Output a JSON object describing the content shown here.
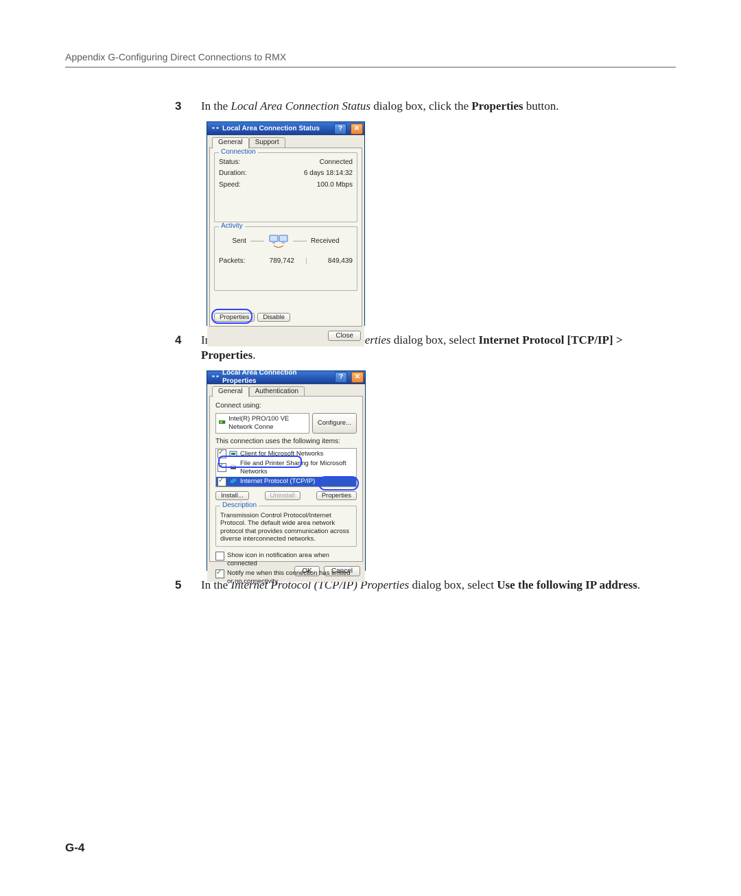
{
  "header": "Appendix G-Configuring Direct Connections to RMX",
  "page_number": "G-4",
  "steps": {
    "s3": {
      "num": "3",
      "t1": "In the ",
      "it1": "Local Area Connection Status",
      "t2": " dialog box, click the ",
      "bd1": "Properties",
      "t3": " button."
    },
    "s4": {
      "num": "4",
      "t1": "In the ",
      "it1": "Local Area Connection Properties",
      "t2": " dialog box, select ",
      "bd1": "Internet Protocol [TCP/IP] > Properties",
      "t3": "."
    },
    "s5": {
      "num": "5",
      "t1": "In the ",
      "it1": "Internet Protocol (TCP/IP) Properties",
      "t2": " dialog box, select ",
      "bd1": "Use the following IP address",
      "t3": "."
    }
  },
  "dlg1": {
    "title": "Local Area Connection Status",
    "tabs": {
      "general": "General",
      "support": "Support"
    },
    "conn_legend": "Connection",
    "status_l": "Status:",
    "status_v": "Connected",
    "duration_l": "Duration:",
    "duration_v": "6 days 18:14:32",
    "speed_l": "Speed:",
    "speed_v": "100.0 Mbps",
    "act_legend": "Activity",
    "sent": "Sent",
    "received": "Received",
    "packets_l": "Packets:",
    "packets_sent": "789,742",
    "packets_recv": "849,439",
    "btn_properties": "Properties",
    "btn_disable": "Disable",
    "btn_close": "Close",
    "help_icon": "help-icon",
    "close_icon": "close-icon"
  },
  "dlg2": {
    "title": "Local Area Connection Properties",
    "tabs": {
      "general": "General",
      "auth": "Authentication"
    },
    "connect_using": "Connect using:",
    "adapter": "Intel(R) PRO/100 VE Network Conne",
    "btn_configure": "Configure...",
    "uses_items": "This connection uses the following items:",
    "items": {
      "i0": "Client for Microsoft Networks",
      "i1": "File and Printer Sharing for Microsoft Networks",
      "i2": "Internet Protocol (TCP/IP)"
    },
    "btn_install": "Install...",
    "btn_uninstall": "Uninstall",
    "btn_properties": "Properties",
    "desc_legend": "Description",
    "desc_text": "Transmission Control Protocol/Internet Protocol. The default wide area network protocol that provides communication across diverse interconnected networks.",
    "chk_show": "Show icon in notification area when connected",
    "chk_notify": "Notify me when this connection has limited or no connectivity",
    "btn_ok": "OK",
    "btn_cancel": "Cancel"
  }
}
